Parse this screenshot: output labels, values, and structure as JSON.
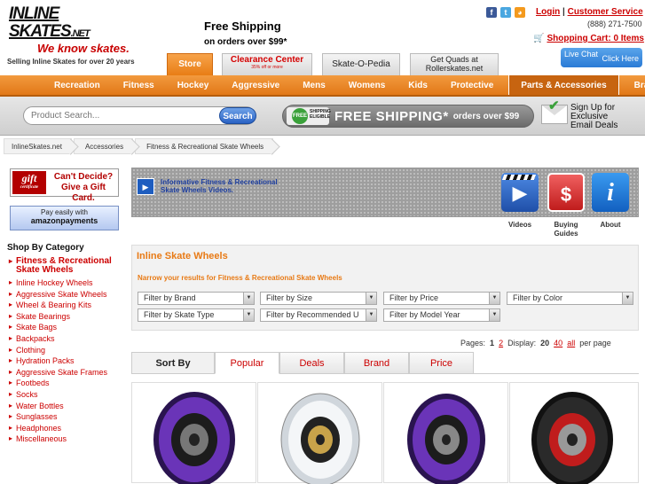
{
  "header": {
    "logo_line1": "INLINE SKATES",
    "logo_net": ".NET",
    "logo_line2": "We know skates.",
    "logo_tagline": "Selling Inline Skates for over 20 years",
    "ship_line1": "Free Shipping",
    "ship_line2": "on orders over $99*",
    "login": "Login",
    "sep": "|",
    "customer_service": "Customer Service",
    "phone": "(888) 271-7500",
    "cart": "Shopping Cart: 0 Items",
    "social_icons": [
      "facebook-icon",
      "twitter-icon",
      "rss-icon"
    ]
  },
  "tabs": {
    "store": "Store",
    "clearance": "Clearance Center",
    "clearance_sub": "35% off or more",
    "pedia": "Skate-O-Pedia",
    "quads1": "Get Quads at",
    "quads2": "Rollerskates.net"
  },
  "livechat": {
    "label": "Live Chat",
    "sub": "Click Here"
  },
  "nav": {
    "items": [
      "Recreation",
      "Fitness",
      "Hockey",
      "Aggressive",
      "Mens",
      "Womens",
      "Kids",
      "Protective",
      "Parts & Accessories",
      "Brands"
    ],
    "active": "Parts & Accessories"
  },
  "search": {
    "placeholder": "Product Search...",
    "button": "Search"
  },
  "freeship": {
    "badge_free": "FREE",
    "badge_text": "SHIPPING ELIGIBLE",
    "big": "FREE SHIPPING*",
    "small": "orders over $99"
  },
  "signup": {
    "line1": "Sign Up for",
    "line2": "Exclusive",
    "line3": "Email Deals"
  },
  "breadcrumb": [
    "InlineSkates.net",
    "Accessories",
    "Fitness & Recreational Skate Wheels"
  ],
  "sidebar": {
    "gift_logo": "gift",
    "gift_logo_sub": "certificate",
    "gift_text1": "Can't Decide?",
    "gift_text2": "Give a Gift Card.",
    "amazon1": "Pay easily with",
    "amazon2": "amazonpayments",
    "shop_by_category": "Shop By Category",
    "categories": [
      "Fitness & Recreational Skate Wheels",
      "Inline Hockey Wheels",
      "Aggressive Skate Wheels",
      "Wheel & Bearing Kits",
      "Skate Bearings",
      "Skate Bags",
      "Backpacks",
      "Clothing",
      "Hydration Packs",
      "Aggressive Skate Frames",
      "Footbeds",
      "Socks",
      "Water Bottles",
      "Sunglasses",
      "Headphones",
      "Miscellaneous"
    ]
  },
  "banner": {
    "text": "Informative Fitness & Recreational Skate Wheels Videos.",
    "videos": "Videos",
    "buying_guides": "Buying Guides",
    "about": "About"
  },
  "panel": {
    "heading": "Inline Skate Wheels",
    "narrow": "Narrow your results for Fitness & Recreational Skate Wheels",
    "filters_row1": [
      "Filter by Brand",
      "Filter by Size",
      "Filter by Price",
      "Filter by Color"
    ],
    "filters_row2": [
      "Filter by Skate Type",
      "Filter by Recommended U",
      "Filter by Model Year"
    ]
  },
  "pagination": {
    "pages_label": "Pages:",
    "page1": "1",
    "page2": "2",
    "display_label": "Display:",
    "d20": "20",
    "d40": "40",
    "dall": "all",
    "per_page": "per page"
  },
  "sort": {
    "label": "Sort By",
    "tabs": [
      "Popular",
      "Deals",
      "Brand",
      "Price"
    ],
    "active": "Popular"
  },
  "products": [
    {
      "name": "labeda-racing-purple-wheel",
      "color": "#5a2a9e",
      "printed": "LABEDA RACING"
    },
    {
      "name": "white-clear-wheel",
      "color": "#e8e8ec",
      "printed": ""
    },
    {
      "name": "labeda-racing-purple-wheel-2",
      "color": "#5a2a9e",
      "printed": "LABEDA RACING"
    },
    {
      "name": "labeda-black-wheel",
      "color": "#222222",
      "printed": "LABEDA"
    }
  ]
}
